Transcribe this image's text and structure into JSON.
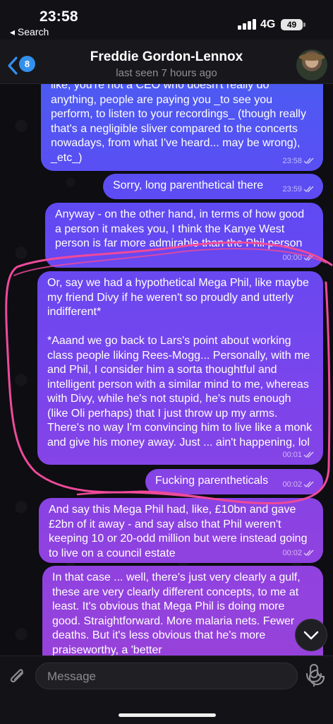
{
  "status_bar": {
    "time": "23:58",
    "back_app": "◂ Search",
    "network": "4G",
    "battery": "49"
  },
  "header": {
    "back_count": "8",
    "contact_name": "Freddie Gordon-Lennox",
    "last_seen": "last seen 7 hours ago"
  },
  "messages": [
    {
      "text": "like, you're not a CEO who doesn't really do anything, people are paying you _to see you perform, to listen to your recordings_ (though really that's a negligible sliver compared to the concerts nowadays, from what I've heard... may be wrong), _etc_)",
      "time": "23:58",
      "status": "read"
    },
    {
      "text": "Sorry, long parenthetical there",
      "time": "23:59",
      "status": "read"
    },
    {
      "text": "Anyway - on the other hand, in terms of how good a person it makes you, I think the Kanye West person is far more admirable than the Phil person",
      "time": "00:00",
      "status": "read"
    },
    {
      "text": "Or, say we had a hypothetical Mega Phil, like maybe my friend Divy if he weren't so proudly and utterly indifferent*\n\n*Aaand we go back to Lars's point about working class people liking Rees-Mogg... Personally, with me and Phil, I consider him a sorta thoughtful and intelligent person with a similar mind to me, whereas with Divy, while he's not stupid, he's nuts enough (like Oli perhaps) that I just throw up my arms. There's no way I'm convincing him to live like a monk and give his money away. Just ... ain't happening, lol",
      "time": "00:01",
      "status": "read"
    },
    {
      "text": "Fucking parentheticals",
      "time": "00:02",
      "status": "read"
    },
    {
      "text": "And say this Mega Phil had, like, £10bn and gave £2bn of it away - and say also that Phil weren't keeping 10 or 20-odd million but were instead going to live on a council estate",
      "time": "00:02",
      "status": "read"
    },
    {
      "text": "In that case ... well, there's just very clearly a gulf, these are very clearly different concepts, to me at least. It's obvious that Mega Phil is doing more good. Straightforward. More malaria nets. Fewer deaths. But it's less obvious that he's more praiseworthy, a 'better",
      "time": "",
      "status": ""
    }
  ],
  "composer": {
    "placeholder": "Message"
  },
  "colors": {
    "bubble_top": "#3f66f2",
    "bubble_bottom": "#9b42d6",
    "annotation": "#ef4a9a",
    "accent": "#3390ec"
  }
}
